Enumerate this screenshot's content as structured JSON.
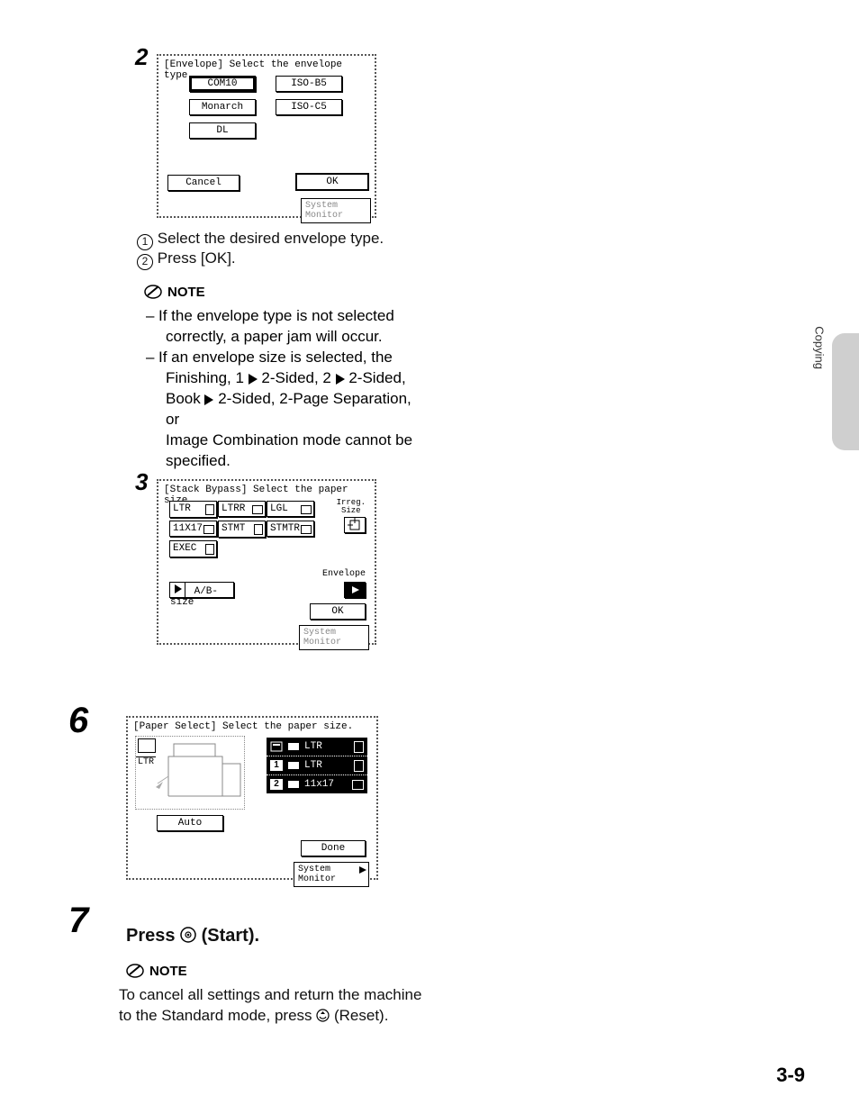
{
  "side": {
    "label": "Copying"
  },
  "folio": "3-9",
  "step2": {
    "num": "2",
    "screen": {
      "title": "[Envelope] Select the envelope type.",
      "opts": {
        "com10": "COM10",
        "isoB5": "ISO-B5",
        "monarch": "Monarch",
        "isoC5": "ISO-C5",
        "dl": "DL"
      },
      "cancel": "Cancel",
      "ok": "OK",
      "sysmon": "System Monitor"
    },
    "text1": "Select the desired envelope type.",
    "text2": "Press [OK]."
  },
  "note1": {
    "label": "NOTE",
    "l1a": "If the envelope type is not selected",
    "l1b": "correctly, a paper jam will occur.",
    "l2a": "If an envelope size is selected, the",
    "l2b1": "Finishing, 1 ",
    "l2b2": " 2-Sided, 2 ",
    "l2b3": " 2-Sided,",
    "l2c1": "Book ",
    "l2c2": " 2-Sided, 2-Page Separation, or",
    "l2d": "Image Combination mode cannot be",
    "l2e": "specified."
  },
  "step3": {
    "num": "3",
    "screen": {
      "title": "[Stack Bypass] Select the paper size.",
      "opts": {
        "ltr": "LTR",
        "ltrR": "LTRR",
        "lgl": "LGL",
        "x11x17": "11X17",
        "stmt": "STMT",
        "stmtR": "STMTR",
        "exec": "EXEC"
      },
      "irreg": "Irreg.\nSize",
      "ab": "A/B-size",
      "env": "Envelope",
      "ok": "OK",
      "sysmon": "System Monitor"
    }
  },
  "step6": {
    "num": "6",
    "screen": {
      "title": "[Paper Select] Select the paper size.",
      "leftLtr": "LTR",
      "auto": "Auto",
      "rows": {
        "r1": "LTR",
        "r2": "LTR",
        "r3": "11x17"
      },
      "done": "Done",
      "sysmon": "System Monitor"
    }
  },
  "step7": {
    "num": "7",
    "heading1": "Press ",
    "heading2": " (Start)."
  },
  "note2": {
    "label": "NOTE",
    "l1": "To cancel all settings and return the machine",
    "l2a": "to the Standard mode, press ",
    "l2b": " (Reset)."
  }
}
